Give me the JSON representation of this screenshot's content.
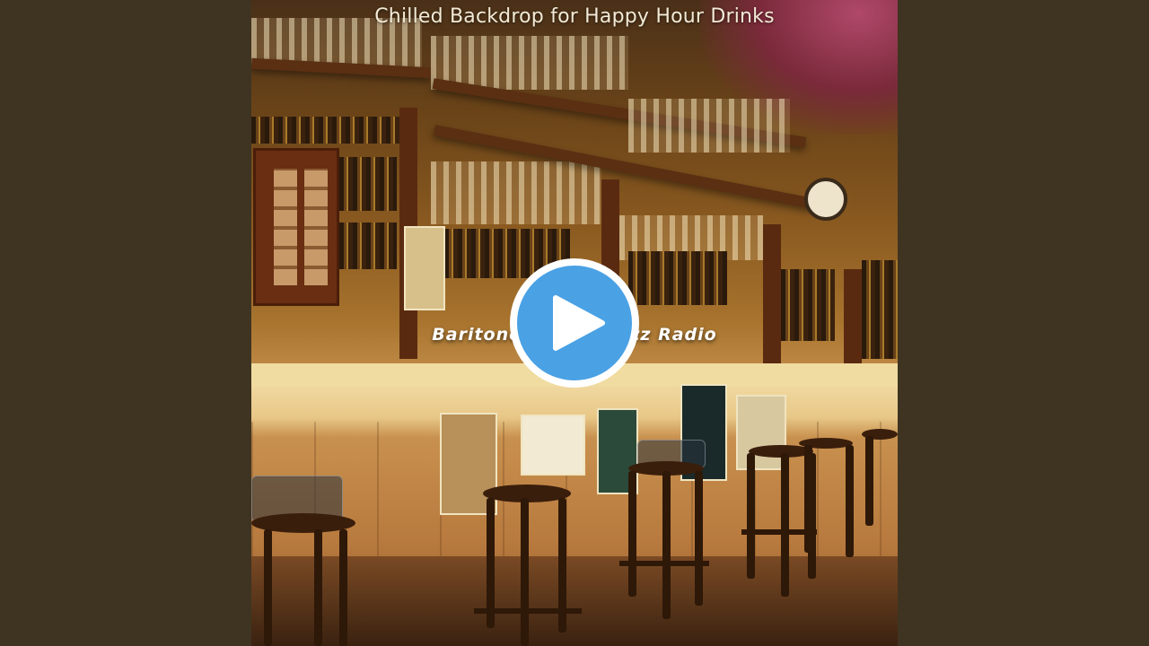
{
  "video": {
    "title": "Chilled Backdrop for Happy Hour Drinks",
    "overlay_text": "Baritone S          Jazz Radio"
  },
  "controls": {
    "play_icon": "play-icon",
    "accent_color": "#4aa1e4"
  },
  "colors": {
    "background": "#3e3320",
    "title_text": "#f2ead6"
  }
}
